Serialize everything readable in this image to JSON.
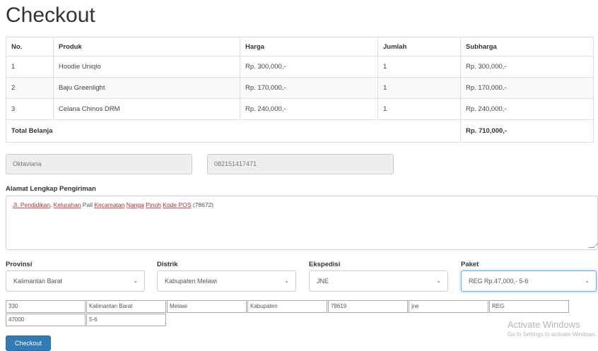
{
  "page": {
    "title": "Checkout"
  },
  "table": {
    "headers": [
      "No.",
      "Produk",
      "Harga",
      "Jumlah",
      "Subharga"
    ],
    "rows": [
      [
        "1",
        "Hoodie Uniqlo",
        "Rp. 300,000,-",
        "1",
        "Rp. 300,000,-"
      ],
      [
        "2",
        "Baju Greenlight",
        "Rp. 170,000,-",
        "1",
        "Rp. 170,000,-"
      ],
      [
        "3",
        "Celana Chinos DRM",
        "Rp. 240,000,-",
        "1",
        "Rp. 240,000,-"
      ]
    ],
    "total_label": "Total Belanja",
    "total_value": "Rp. 710,000,-"
  },
  "customer": {
    "name": "Oktaviana",
    "phone": "082151417471"
  },
  "address": {
    "label": "Alamat Lengkap Pengiriman",
    "parts": {
      "a": "Jl. Pendidikan",
      "b": "Kelurahan",
      "c": "Pall",
      "d": "Kecamatan",
      "e": "Nanga",
      "f": "Pinoh",
      "g": "Kode POS",
      "h": "(78672)"
    }
  },
  "shipping": {
    "provinsi": {
      "label": "Provinsi",
      "value": "Kalimantan Barat"
    },
    "distrik": {
      "label": "Distrik",
      "value": "Kabupaten Melawi"
    },
    "ekspedisi": {
      "label": "Ekspedisi",
      "value": "JNE"
    },
    "paket": {
      "label": "Paket",
      "value": "REG Rp.47,000,- 5-6"
    }
  },
  "hidden_fields": {
    "row1": [
      "330",
      "Kalimantan Barat",
      "Melawi",
      "Kabupaten",
      "78619",
      "jne",
      "REG"
    ],
    "row2": [
      "47000",
      "5-6"
    ]
  },
  "actions": {
    "checkout_label": "Checkout"
  },
  "watermark": {
    "line1": "Activate Windows",
    "line2": "Go to Settings to activate Windows."
  },
  "colors": {
    "primary": "#337ab7",
    "focus": "#66afe9"
  }
}
